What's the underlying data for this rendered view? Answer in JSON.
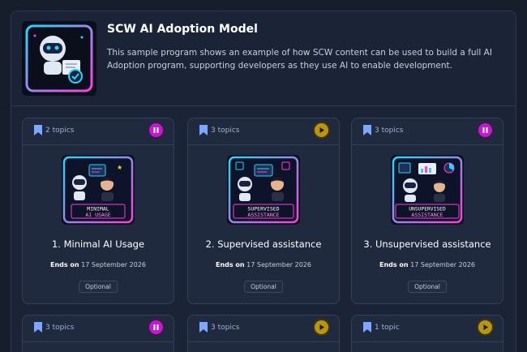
{
  "program": {
    "title": "SCW AI Adoption Model",
    "description": "This sample program shows an example of how SCW content can be used to build a full AI Adoption program, supporting developers as they use AI to enable development."
  },
  "cards": [
    {
      "topics": "2 topics",
      "action": "pause",
      "thumb_line1": "MINIMAL",
      "thumb_line2": "AI USAGE",
      "title": "1. Minimal AI Usage",
      "ends_label": "Ends on",
      "ends_date": "17 September 2026",
      "badge": "Optional"
    },
    {
      "topics": "3 topics",
      "action": "play",
      "thumb_line1": "SUPERVISED",
      "thumb_line2": "ASSISTANCE",
      "title": "2. Supervised assistance",
      "ends_label": "Ends on",
      "ends_date": "17 September 2026",
      "badge": "Optional"
    },
    {
      "topics": "3 topics",
      "action": "pause",
      "thumb_line1": "UNSUPERVISED",
      "thumb_line2": "ASSISTANCE",
      "title": "3. Unsupervised assistance",
      "ends_label": "Ends on",
      "ends_date": "17 September 2026",
      "badge": "Optional"
    },
    {
      "topics": "3 topics",
      "action": "pause"
    },
    {
      "topics": "3 topics",
      "action": "play"
    },
    {
      "topics": "1 topic",
      "action": "play"
    }
  ],
  "colors": {
    "pause": "#c21ad0",
    "play": "#b9960e",
    "accent_cyan": "#29d3ff",
    "accent_pink": "#ff3fd8"
  },
  "icons": {
    "bookmark": "bookmark-icon",
    "pause": "pause-icon",
    "play": "play-icon"
  }
}
